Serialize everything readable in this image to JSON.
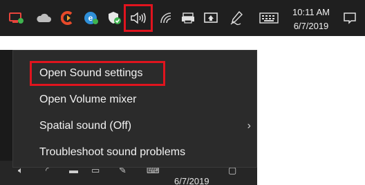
{
  "taskbar": {
    "icons": [
      "remote-desktop-icon",
      "onedrive-cloud-icon",
      "ccleaner-icon",
      "edge-browser-icon",
      "windows-security-shield-icon",
      "speaker-volume-icon",
      "wifi-network-icon",
      "printer-icon",
      "display-projector-icon",
      "pen-ink-workspace-icon",
      "touch-keyboard-icon",
      "action-center-notification-icon"
    ],
    "time": "10:11 AM",
    "date": "6/7/2019"
  },
  "context_menu": {
    "items": [
      {
        "label": "Open Sound settings",
        "highlighted": true
      },
      {
        "label": "Open Volume mixer"
      },
      {
        "label": "Spatial sound (Off)",
        "has_submenu": true
      },
      {
        "label": "Troubleshoot sound problems"
      }
    ]
  },
  "bottom_taskbar": {
    "date": "6/7/2019"
  },
  "colors": {
    "highlight": "#e0141e",
    "taskbar_bg": "#1f1f1f",
    "menu_bg": "#2b2b2b",
    "menu_text": "#f2f2f2"
  }
}
